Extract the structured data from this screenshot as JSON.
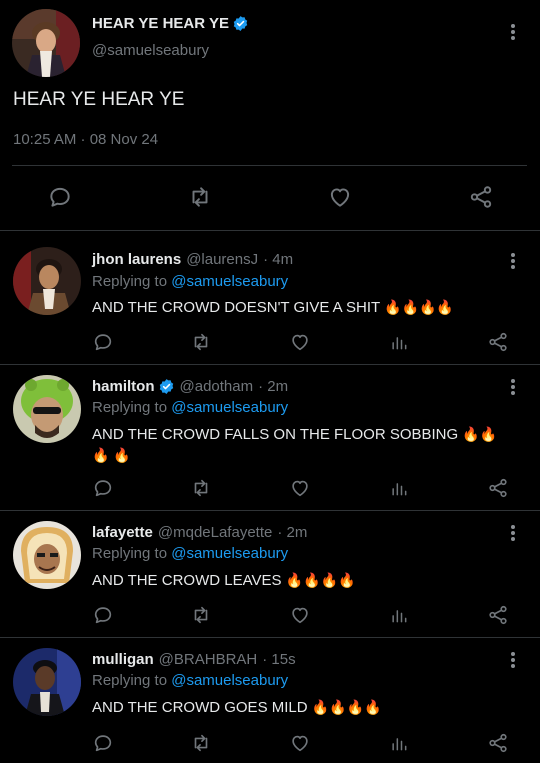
{
  "main_tweet": {
    "display_name": "HEAR YE HEAR YE",
    "handle": "@samuelseabury",
    "text": "HEAR YE HEAR YE",
    "timestamp": "10:25 AM · 08 Nov 24",
    "verified": true,
    "actions": [
      "reply-icon",
      "retweet-icon",
      "like-icon",
      "share-icon"
    ]
  },
  "replies": [
    {
      "display_name": "jhon laurens",
      "handle": "@laurensJ",
      "time": "· 4m",
      "replying_prefix": "Replying to ",
      "replying_to": "@samuelseabury",
      "text": "AND THE CROWD DOESN'T GIVE A SHIT",
      "emoji": "🔥🔥🔥🔥",
      "verified": false
    },
    {
      "display_name": "hamilton",
      "handle": "@adotham",
      "time": "· 2m",
      "replying_prefix": "Replying to ",
      "replying_to": "@samuelseabury",
      "text": "AND THE CROWD FALLS ON THE FLOOR SOBBING",
      "emoji": "🔥🔥🔥 🔥",
      "verified": true
    },
    {
      "display_name": "lafayette",
      "handle": "@mqdeLafayette",
      "time": "· 2m",
      "replying_prefix": "Replying to ",
      "replying_to": "@samuelseabury",
      "text": "AND THE CROWD LEAVES",
      "emoji": "🔥🔥🔥🔥",
      "verified": false
    },
    {
      "display_name": "mulligan",
      "handle": "@BRAHBRAH",
      "time": "· 15s",
      "replying_prefix": "Replying to ",
      "replying_to": "@samuelseabury",
      "text": "AND THE CROWD GOES MILD",
      "emoji": "🔥🔥🔥🔥",
      "verified": false
    }
  ],
  "colors": {
    "background": "#000000",
    "text": "#e7e9ea",
    "muted": "#71767b",
    "accent": "#1d9bf0",
    "divider": "#2f3336"
  }
}
